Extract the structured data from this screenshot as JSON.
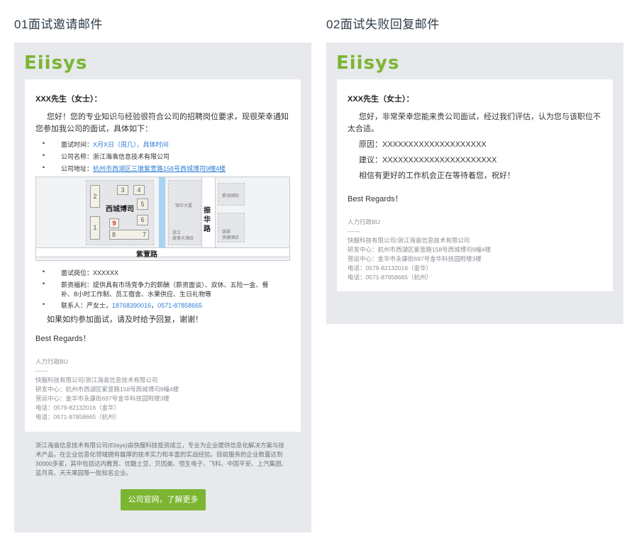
{
  "sections": [
    {
      "title": "01面试邀请邮件"
    },
    {
      "title": "02面试失败回复邮件"
    }
  ],
  "logo_text": "Eiisys",
  "invite": {
    "greeting": "XXX先生（女士）：",
    "intro_line1": "您好！您的专业知识与经验很符合公司的招聘岗位要求，现很荣幸通知",
    "intro_line2": "您参加我公司的面试，具体如下：",
    "time_label": "面试时间：",
    "time_value": "X月X日（周几），具体时间",
    "company_label": "公司名称：浙江海翕信息技术有限公司",
    "address_label": "公司地址：",
    "address_value": "杭州市西湖区三墩紫萱路158号西城博司9幢4楼",
    "map": {
      "building_name": "西城博司",
      "rooms": [
        "2",
        "3",
        "4",
        "5",
        "6",
        "7",
        "8",
        "1",
        "9"
      ],
      "road_v": [
        "振",
        "华",
        "路"
      ],
      "road_h": "紫萱路",
      "hotel1": "锦华大厦",
      "hotel2_line1": "浙江",
      "hotel2_line2": "度豪大酒店",
      "place3": "紫润国际",
      "place4_line1": "锦翠",
      "place4_line2": "快捷酒店"
    },
    "position_label": "面试岗位：XXXXXX",
    "benefit_line1": "薪资福利：提供具有市场竞争力的薪酬（薪资面谈）、双休、五险一金、餐",
    "benefit_line2": "补、8小时工作制、员工宿舍、水果供应、生日礼物等",
    "contact_label": "联系人：严女士，",
    "contact_phone1": "18768390016",
    "contact_sep": "，",
    "contact_phone2": "0571-87858665",
    "closing": "如果如约参加面试，请及时给予回复，谢谢！",
    "regards": "Best Regards！",
    "sig_dept": "人力行政BU",
    "sig_dash": "------",
    "sig_company": "快服科技有限公司/浙江海翕信息技术有限公司",
    "sig_rd": "研发中心：杭州市西湖区紫萱路158号西城博司9幢4楼",
    "sig_ops": "营运中心：金华市永康街697号金华科技园附楼3楼",
    "sig_tel1": "电话：0579-82132016（金华）",
    "sig_tel2": "电话：0571-87858665（杭州）",
    "footer_text": "浙江海翕信息技术有限公司(Eiisys)由快服科技投资成立，专业为企业提供信息化解决方案与技术产品，在企业信息化领域拥有雄厚的技术实力和丰富的实战经验。目前服务的企业数量达到30000多家，其中包括达内教育、优酷土豆、贝因美、恒生电子、飞科、中国平安、上汽集团、蓝月亮、天天果园等一批知名企业。",
    "cta": "公司官网，了解更多"
  },
  "reject": {
    "greeting": "XXX先生（女士）：",
    "intro_line1": "您好，非常荣幸您能来贵公司面试，经过我们评估，认为您与该职位不",
    "intro_line2": "太合适。",
    "reason": "原因：XXXXXXXXXXXXXXXXXXXX",
    "advice": "建议：XXXXXXXXXXXXXXXXXXXXXX",
    "wish": "相信有更好的工作机会正在等待着您，祝好！",
    "regards": "Best Regards！",
    "sig_dept": "人力行政BU",
    "sig_dash": "------",
    "sig_company": "快服科技有限公司/浙江海翕信息技术有限公司",
    "sig_rd": "研发中心：杭州市西湖区紫萱路158号西城博司9幢4楼",
    "sig_ops": "营运中心：金华市永康街697号金华科技园附楼3楼",
    "sig_tel1": "电话：0579-82132016（金华）",
    "sig_tel2": "电话：0571-87858665（杭州）"
  },
  "colors": {
    "accent": "#7bb531",
    "link": "#2f7fd6",
    "panel": "#e7e9ec",
    "title": "#2f3d4a"
  }
}
